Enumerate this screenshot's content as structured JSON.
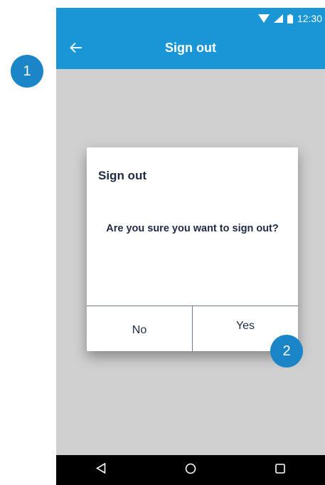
{
  "status_bar": {
    "time": "12:30",
    "icons": [
      "wifi-icon",
      "signal-icon",
      "battery-icon"
    ]
  },
  "app_bar": {
    "back_icon": "arrow-left-icon",
    "title": "Sign out"
  },
  "dialog": {
    "title": "Sign out",
    "message": "Are you sure you want to sign out?",
    "no_label": "No",
    "yes_label": "Yes"
  },
  "nav_bar": {
    "items": [
      "back-triangle-icon",
      "home-circle-icon",
      "recents-square-icon"
    ]
  },
  "callouts": {
    "one": "1",
    "two": "2"
  },
  "colors": {
    "primary": "#1a96d6",
    "callout": "#1a86c8",
    "scrim": "#d0d0d0",
    "text": "#1f2a44"
  }
}
